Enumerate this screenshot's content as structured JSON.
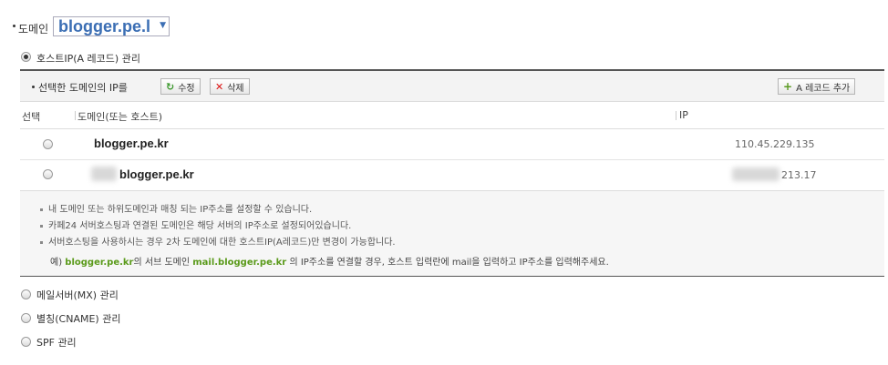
{
  "domain": {
    "label": "도메인",
    "selected": "blogger.pe.l"
  },
  "host_ip": {
    "radio_label": "호스트IP(A 레코드) 관리",
    "panel_title": "선택한 도메인의 IP를",
    "edit_button": "수정",
    "delete_button": "삭제",
    "add_button": "A 레코드 추가"
  },
  "table": {
    "columns": [
      "선택",
      "도메인(또는 호스트)",
      "IP"
    ],
    "rows": [
      {
        "host": "blogger.pe.kr",
        "ip": "110.45.229.135"
      },
      {
        "host": "blogger.pe.kr",
        "ip": "213.17"
      }
    ]
  },
  "notes": [
    "내 도메인 또는 하위도메인과 매칭 되는 IP주소를 설정할 수 있습니다.",
    "카페24 서버호스팅과 연결된 도메인은 해당 서버의 IP주소로 설정되어있습니다.",
    "서버호스팅을 사용하시는 경우 2차 도메인에 대한 호스트IP(A레코드)만 변경이 가능합니다."
  ],
  "example": {
    "prefix": "예)",
    "domain": "blogger.pe.kr",
    "mid1": "의 서브 도메인",
    "subdomain": "mail.blogger.pe.kr",
    "mid2": "의 IP주소를 연결할 경우, 호스트 입력란에 mail을 입력하고 IP주소를 입력해주세요."
  },
  "other_options": [
    "메일서버(MX) 관리",
    "별칭(CNAME) 관리",
    "SPF 관리"
  ]
}
